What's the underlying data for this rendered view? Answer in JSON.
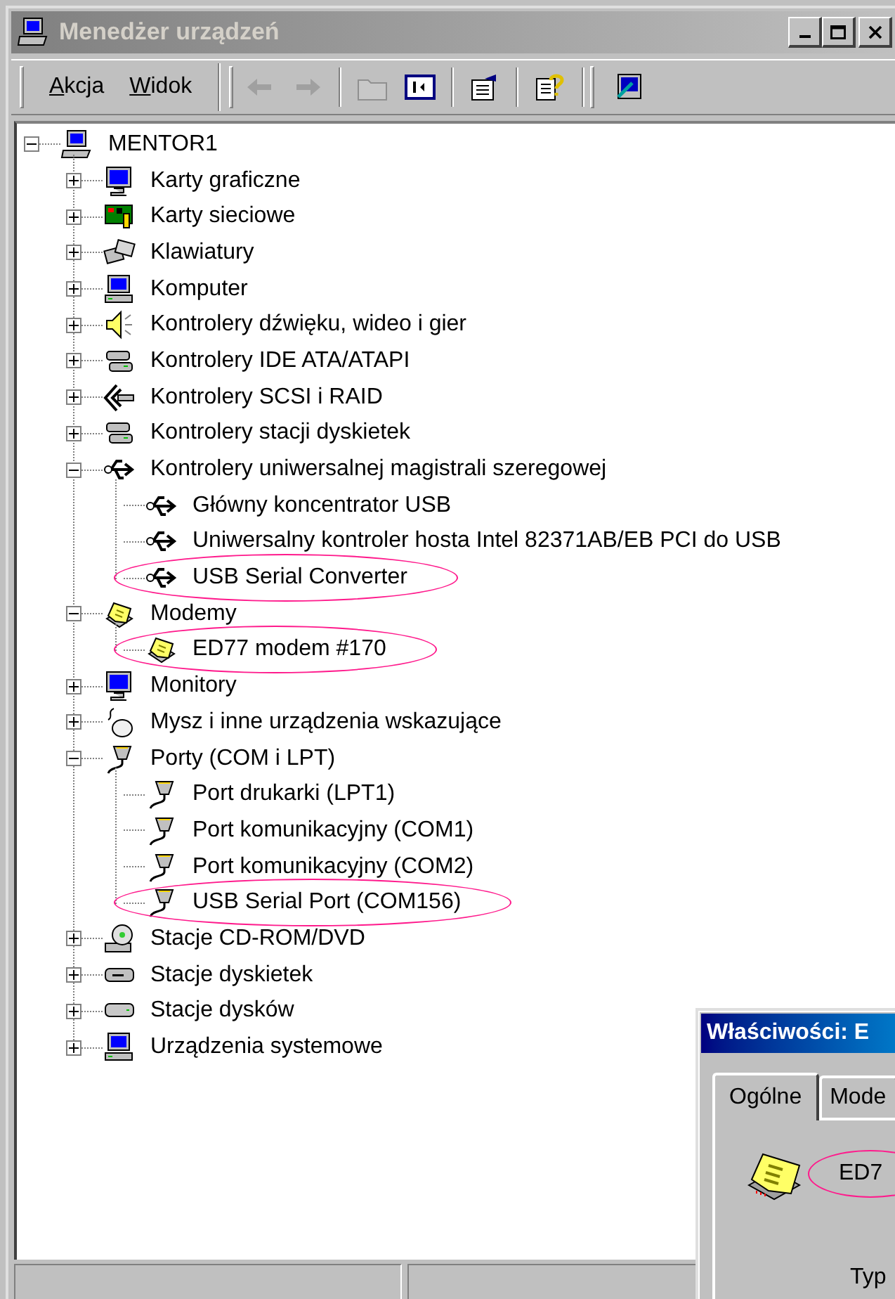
{
  "window": {
    "title": "Menedżer urządzeń"
  },
  "menu": [
    {
      "label": "Akcja"
    },
    {
      "label": "Widok"
    }
  ],
  "toolbar": [
    [
      {
        "kind": "back",
        "disabled": true
      },
      {
        "kind": "forward",
        "disabled": true
      }
    ],
    [
      {
        "kind": "up",
        "disabled": true
      },
      {
        "kind": "tree_toggle",
        "disabled": false
      }
    ],
    [
      {
        "kind": "properties",
        "disabled": false
      }
    ],
    [
      {
        "kind": "help",
        "disabled": false
      }
    ],
    [
      {
        "kind": "scan",
        "disabled": false
      }
    ]
  ],
  "tree": {
    "label": "MENTOR1",
    "kind": "computer",
    "expanded": true,
    "highlighted": false,
    "children": [
      {
        "label": "Karty graficzne",
        "kind": "monitor",
        "expanded": false,
        "highlighted": false
      },
      {
        "label": "Karty sieciowe",
        "kind": "network",
        "expanded": false,
        "highlighted": false
      },
      {
        "label": "Klawiatury",
        "kind": "keyboard",
        "expanded": false,
        "highlighted": false
      },
      {
        "label": "Komputer",
        "kind": "pc",
        "expanded": false,
        "highlighted": false
      },
      {
        "label": "Kontrolery dźwięku, wideo i gier",
        "kind": "sound",
        "expanded": false,
        "highlighted": false
      },
      {
        "label": "Kontrolery IDE ATA/ATAPI",
        "kind": "ide",
        "expanded": false,
        "highlighted": false
      },
      {
        "label": "Kontrolery SCSI i RAID",
        "kind": "scsi",
        "expanded": false,
        "highlighted": false
      },
      {
        "label": "Kontrolery stacji dyskietek",
        "kind": "ide",
        "expanded": false,
        "highlighted": false
      },
      {
        "label": "Kontrolery uniwersalnej magistrali szeregowej",
        "kind": "usb",
        "expanded": true,
        "highlighted": false,
        "children": [
          {
            "label": "Główny koncentrator USB",
            "kind": "usb",
            "highlighted": false
          },
          {
            "label": "Uniwersalny kontroler hosta Intel 82371AB/EB PCI do USB",
            "kind": "usb",
            "highlighted": false
          },
          {
            "label": "USB Serial Converter",
            "kind": "usb",
            "highlighted": true
          }
        ]
      },
      {
        "label": "Modemy",
        "kind": "modem",
        "expanded": true,
        "highlighted": false,
        "children": [
          {
            "label": "ED77 modem #170",
            "kind": "modem",
            "highlighted": true
          }
        ]
      },
      {
        "label": "Monitory",
        "kind": "monitor",
        "expanded": false,
        "highlighted": false
      },
      {
        "label": "Mysz i inne urządzenia wskazujące",
        "kind": "mouse",
        "expanded": false,
        "highlighted": false
      },
      {
        "label": "Porty (COM i LPT)",
        "kind": "port",
        "expanded": true,
        "highlighted": false,
        "children": [
          {
            "label": "Port drukarki (LPT1)",
            "kind": "port",
            "highlighted": false
          },
          {
            "label": "Port komunikacyjny (COM1)",
            "kind": "port",
            "highlighted": false
          },
          {
            "label": "Port komunikacyjny (COM2)",
            "kind": "port",
            "highlighted": false
          },
          {
            "label": "USB Serial Port (COM156)",
            "kind": "port",
            "highlighted": true
          }
        ]
      },
      {
        "label": "Stacje CD-ROM/DVD",
        "kind": "cdrom",
        "expanded": false,
        "highlighted": false
      },
      {
        "label": "Stacje dyskietek",
        "kind": "floppy",
        "expanded": false,
        "highlighted": false
      },
      {
        "label": "Stacje dysków",
        "kind": "disk",
        "expanded": false,
        "highlighted": false
      },
      {
        "label": "Urządzenia systemowe",
        "kind": "pc",
        "expanded": false,
        "highlighted": false
      }
    ]
  },
  "dialog": {
    "title": "Właściwości: E",
    "tabs": [
      {
        "label": "Ogólne",
        "selected": true
      },
      {
        "label": "Mode",
        "selected": false
      }
    ],
    "device": {
      "name": "ED7",
      "highlighted": true
    },
    "field_label": "Typ"
  }
}
